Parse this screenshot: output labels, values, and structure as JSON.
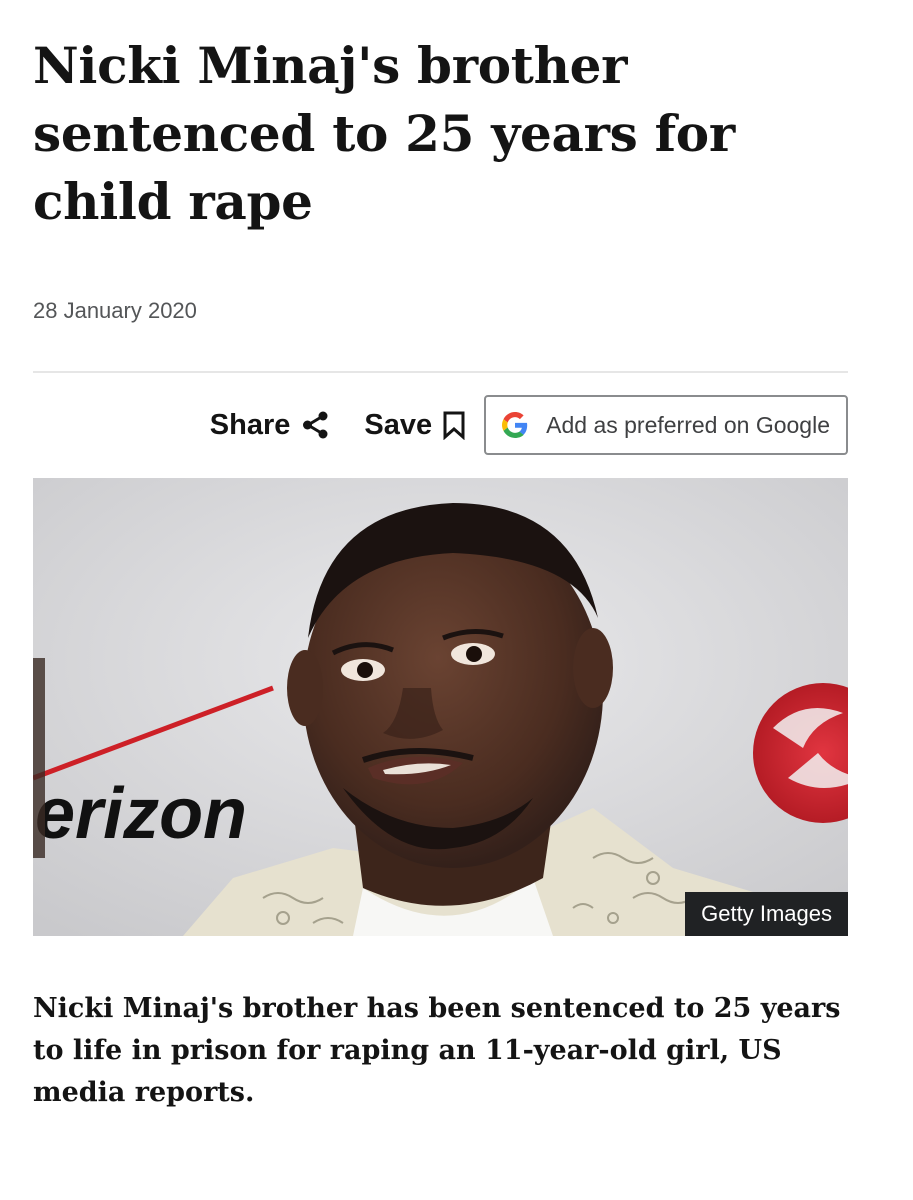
{
  "article": {
    "headline": "Nicki Minaj's brother sentenced to 25 years for child rape",
    "date": "28 January 2020",
    "summary": "Nicki Minaj's brother has been sentenced to 25 years to life in prison for raping an 11-year-old girl, US media reports."
  },
  "actions": {
    "share_label": "Share",
    "share_icon": "share-icon",
    "save_label": "Save",
    "save_icon": "bookmark-icon",
    "google_label": "Add as preferred on Google",
    "google_icon": "google-g-icon"
  },
  "image": {
    "credit": "Getty Images",
    "backdrop_text": "erizon"
  },
  "colors": {
    "text": "#141414",
    "date": "#545658",
    "credit_bg": "#202224",
    "brand_red": "#cd2027"
  }
}
